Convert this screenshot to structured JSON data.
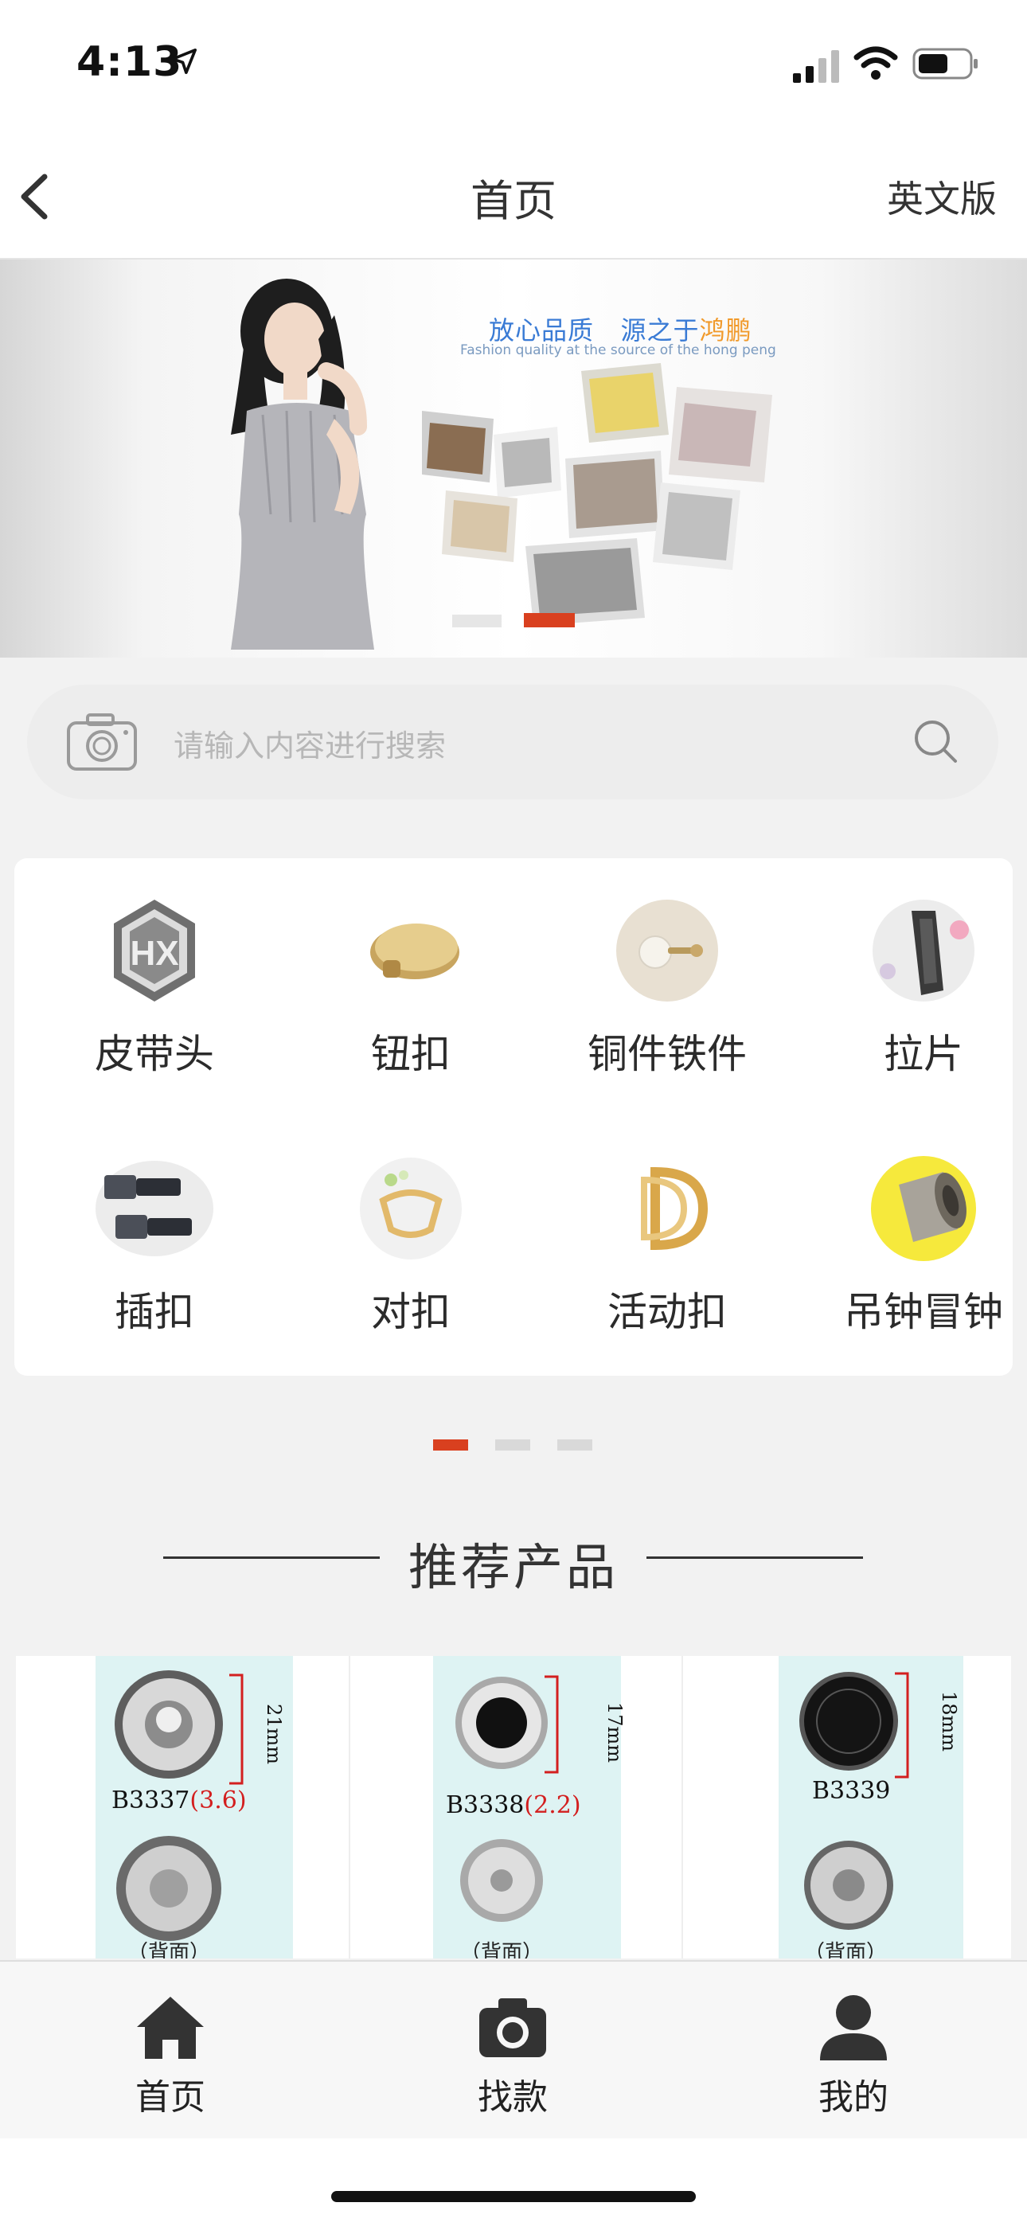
{
  "status_bar": {
    "time": "4:13"
  },
  "navbar": {
    "title": "首页",
    "right_label": "英文版"
  },
  "banner": {
    "headline_blue": "放心品质",
    "headline_blue2": "源之于",
    "headline_orange": "鸿鹏",
    "subtitle": "Fashion quality at the source of the hong peng"
  },
  "search": {
    "placeholder": "请输入内容进行搜索"
  },
  "categories": [
    {
      "label": "皮带头"
    },
    {
      "label": "钮扣"
    },
    {
      "label": "铜件铁件"
    },
    {
      "label": "拉片"
    },
    {
      "label": "插扣"
    },
    {
      "label": "对扣"
    },
    {
      "label": "活动扣"
    },
    {
      "label": "吊钟冒钟"
    }
  ],
  "section": {
    "title": "推荐产品"
  },
  "products": [
    {
      "code": "B3337",
      "spec": "(3.6)",
      "size": "21mm",
      "back_label": "（背面）"
    },
    {
      "code": "B3338",
      "spec": "(2.2)",
      "size": "17mm",
      "back_label": "（背面）"
    },
    {
      "code": "B3339",
      "spec": "",
      "size": "18mm",
      "back_label": "（背面）"
    }
  ],
  "tabbar": [
    {
      "label": "首页",
      "icon": "home-icon"
    },
    {
      "label": "找款",
      "icon": "camera-icon"
    },
    {
      "label": "我的",
      "icon": "user-icon"
    }
  ],
  "colors": {
    "accent": "#d9401f",
    "search_bg": "#ededed",
    "page_bg": "#f2f2f2"
  }
}
